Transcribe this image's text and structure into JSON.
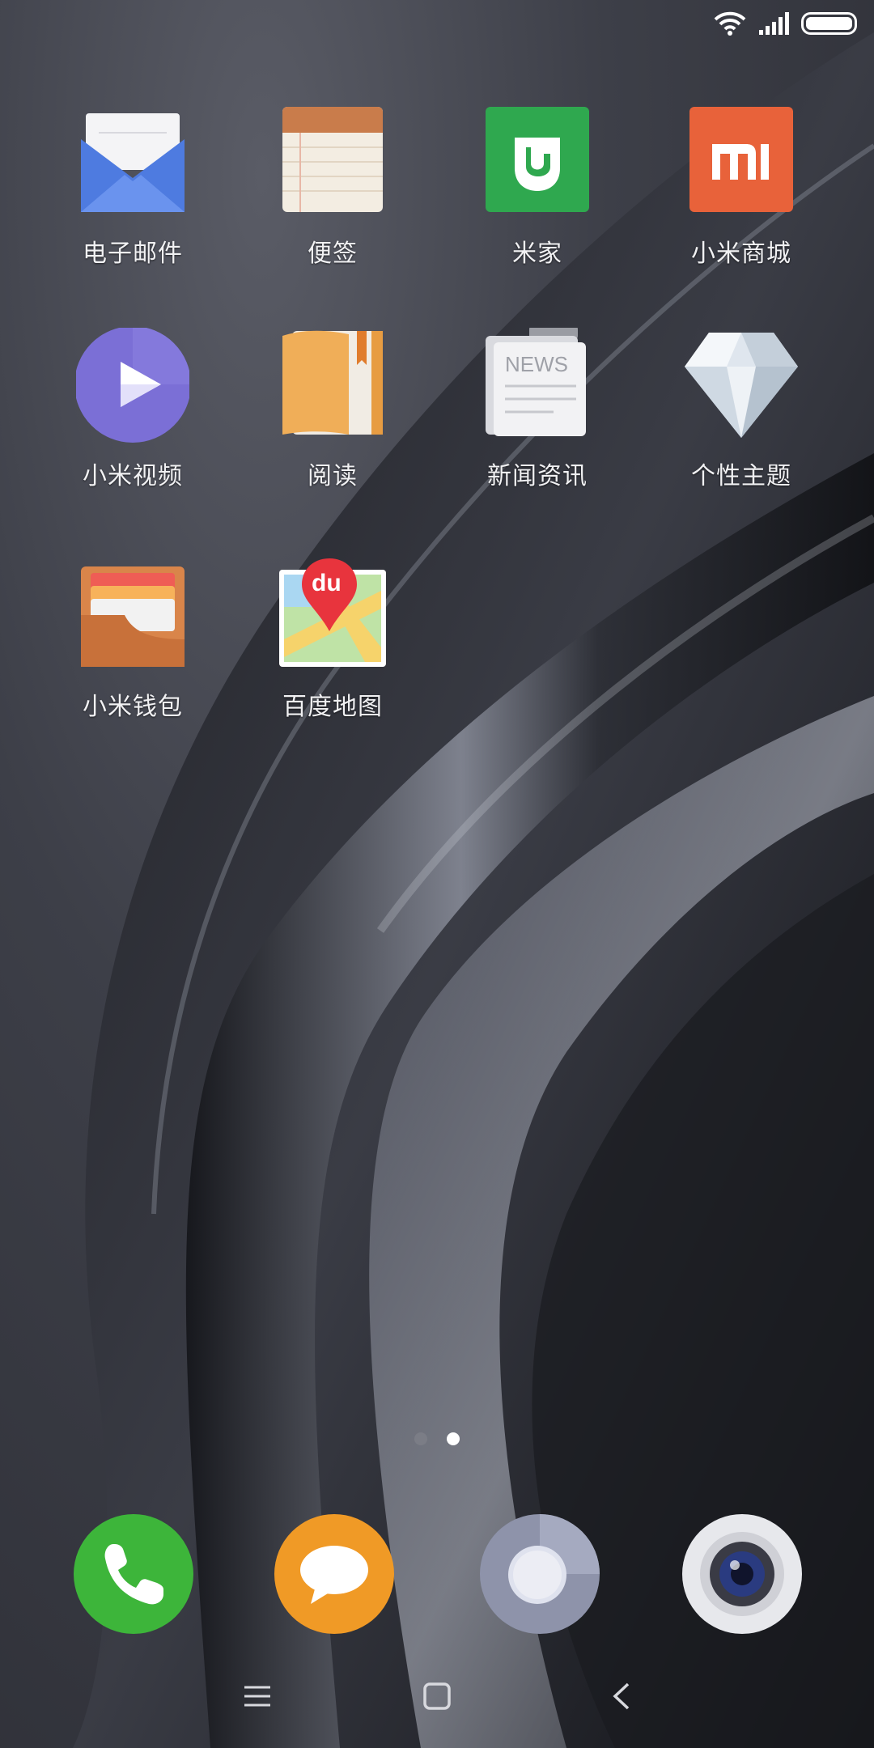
{
  "status_bar": {
    "wifi_icon": "wifi-icon",
    "signal_icon": "signal-icon",
    "battery_icon": "battery-icon"
  },
  "apps": [
    {
      "label": "电子邮件",
      "icon": "email-icon"
    },
    {
      "label": "便签",
      "icon": "notes-icon"
    },
    {
      "label": "米家",
      "icon": "mijia-icon"
    },
    {
      "label": "小米商城",
      "icon": "mi-store-icon"
    },
    {
      "label": "小米视频",
      "icon": "video-icon"
    },
    {
      "label": "阅读",
      "icon": "reader-icon"
    },
    {
      "label": "新闻资讯",
      "icon": "news-icon"
    },
    {
      "label": "个性主题",
      "icon": "themes-icon"
    },
    {
      "label": "小米钱包",
      "icon": "wallet-icon"
    },
    {
      "label": "百度地图",
      "icon": "baidu-map-icon"
    }
  ],
  "icon_text": {
    "news": "NEWS",
    "baidu": "du"
  },
  "page_indicator": {
    "total": 2,
    "active": 2
  },
  "dock": [
    "phone-icon",
    "messages-icon",
    "browser-icon",
    "camera-icon"
  ],
  "nav": [
    "menu-icon",
    "home-icon",
    "back-icon"
  ],
  "colors": {
    "mijia": "#2fa84f",
    "mi_store": "#e8623a",
    "video": "#7b6fd6",
    "phone": "#3db53a",
    "messages": "#f09a26"
  }
}
